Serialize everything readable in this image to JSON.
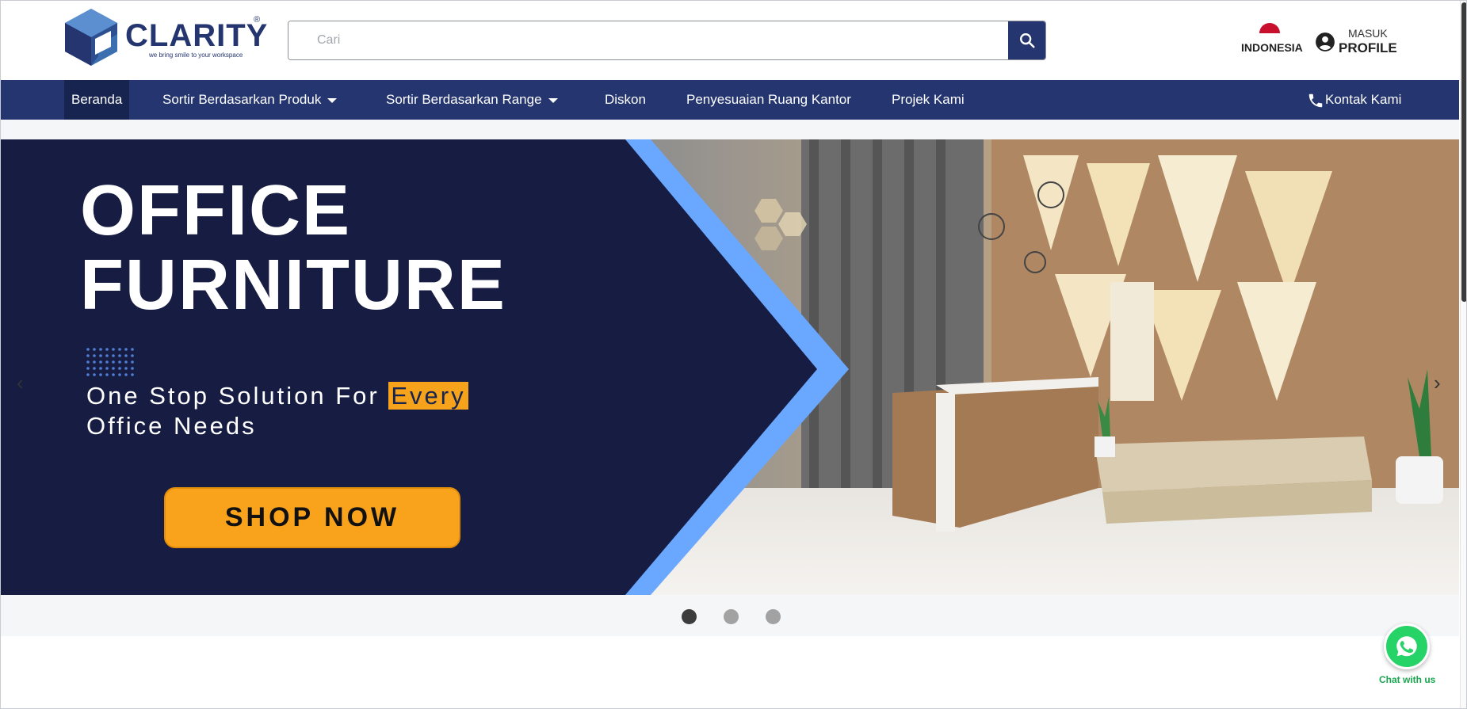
{
  "header": {
    "logo_text": "CLARITY",
    "logo_reg": "®",
    "logo_tagline": "we bring smile to your workspace",
    "search_placeholder": "Cari",
    "language_label": "INDONESIA",
    "profile_small": "MASUK",
    "profile_big": "PROFILE"
  },
  "nav": {
    "items": [
      {
        "label": "Beranda"
      },
      {
        "label": "Sortir Berdasarkan Produk"
      },
      {
        "label": "Sortir Berdasarkan Range"
      },
      {
        "label": "Diskon"
      },
      {
        "label": "Penyesuaian Ruang Kantor"
      },
      {
        "label": "Projek Kami"
      }
    ],
    "contact_label": "Kontak Kami"
  },
  "banner": {
    "title_line1": "OFFICE",
    "title_line2": "FURNITURE",
    "tagline_part1": "One Stop Solution For ",
    "tagline_highlight": "Every",
    "tagline_line2": "Office Needs",
    "cta_label": "SHOP NOW",
    "prev_arrow": "‹",
    "next_arrow": "›",
    "slides_total": 3,
    "active_slide": 1
  },
  "whatsapp": {
    "label": "Chat with us"
  },
  "colors": {
    "brand_navy": "#24356f",
    "banner_navy": "#171d42",
    "accent_blue": "#6aa7ff",
    "accent_orange": "#f9a21b",
    "whatsapp_green": "#25d366"
  }
}
